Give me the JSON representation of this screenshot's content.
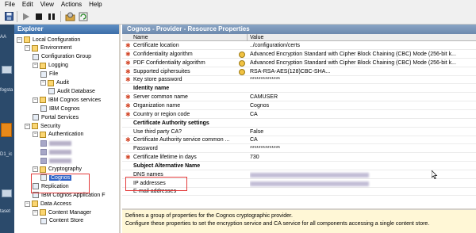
{
  "menu": [
    "File",
    "Edit",
    "View",
    "Actions",
    "Help"
  ],
  "toolbar": {
    "icons": [
      "save-icon",
      "play-icon",
      "stop-icon",
      "pause-icon",
      "tools-icon",
      "refresh-icon"
    ]
  },
  "background_window": {
    "labels": [
      "AA",
      "fogsta",
      "D1_ic",
      "taset"
    ]
  },
  "explorer": {
    "title": "Explorer",
    "tree": [
      {
        "label": "Local Configuration",
        "level": 0,
        "expander": "−"
      },
      {
        "label": "Environment",
        "level": 1,
        "expander": "−"
      },
      {
        "label": "Configuration Group",
        "level": 2,
        "expander": ""
      },
      {
        "label": "Logging",
        "level": 2,
        "expander": "−"
      },
      {
        "label": "File",
        "level": 3,
        "expander": ""
      },
      {
        "label": "Audit",
        "level": 3,
        "expander": "−"
      },
      {
        "label": "Audit Database",
        "level": 4,
        "expander": ""
      },
      {
        "label": "IBM Cognos services",
        "level": 2,
        "expander": "−"
      },
      {
        "label": "IBM Cognos",
        "level": 3,
        "expander": ""
      },
      {
        "label": "Portal Services",
        "level": 2,
        "expander": ""
      },
      {
        "label": "Security",
        "level": 1,
        "expander": "−"
      },
      {
        "label": "Authentication",
        "level": 2,
        "expander": "−"
      },
      {
        "label": "",
        "level": 3,
        "expander": ""
      },
      {
        "label": "",
        "level": 3,
        "expander": ""
      },
      {
        "label": "",
        "level": 3,
        "expander": ""
      },
      {
        "label": "Cryptography",
        "level": 2,
        "expander": "−"
      },
      {
        "label": "Cognos",
        "level": 3,
        "expander": "",
        "selected": true
      },
      {
        "label": "Replication",
        "level": 2,
        "expander": ""
      },
      {
        "label": "IBM Cognos Application F",
        "level": 2,
        "expander": ""
      },
      {
        "label": "Data Access",
        "level": 1,
        "expander": "−"
      },
      {
        "label": "Content Manager",
        "level": 2,
        "expander": "−"
      },
      {
        "label": "Content Store",
        "level": 3,
        "expander": ""
      }
    ]
  },
  "properties": {
    "title": "Cognos - Provider - Resource Properties",
    "columns": {
      "name": "Name",
      "value": "Value"
    },
    "rows": [
      {
        "type": "row",
        "required": true,
        "name": "Certificate location",
        "value": "../configuration/certs",
        "icon": false
      },
      {
        "type": "row",
        "required": true,
        "name": "Confidentiality algorithm",
        "value": "Advanced Encryption Standard with Cipher Block Chaining (CBC) Mode (256-bit k...",
        "icon": true
      },
      {
        "type": "row",
        "required": true,
        "name": "PDF Confidentiality algorithm",
        "value": "Advanced Encryption Standard with Cipher Block Chaining (CBC) Mode (256-bit k...",
        "icon": true
      },
      {
        "type": "row",
        "required": true,
        "name": "Supported ciphersuites",
        "value": "RSA-RSA-AES(128)CBC-SHA...",
        "icon": true
      },
      {
        "type": "row",
        "required": true,
        "name": "Key store password",
        "value": "**************",
        "icon": false
      },
      {
        "type": "section",
        "name": "Identity name"
      },
      {
        "type": "row",
        "required": true,
        "name": "Server common name",
        "value": "CAMUSER",
        "icon": false
      },
      {
        "type": "row",
        "required": true,
        "name": "Organization name",
        "value": "Cognos",
        "icon": false
      },
      {
        "type": "row",
        "required": true,
        "name": "Country or region code",
        "value": "CA",
        "icon": false
      },
      {
        "type": "section",
        "name": "Certificate Authority settings"
      },
      {
        "type": "row",
        "required": false,
        "name": "Use third party CA?",
        "value": "False",
        "icon": false
      },
      {
        "type": "row",
        "required": true,
        "name": "Certificate Authority service common ...",
        "value": "CA",
        "icon": false
      },
      {
        "type": "row",
        "required": false,
        "name": "Password",
        "value": "**************",
        "icon": false
      },
      {
        "type": "row",
        "required": true,
        "name": "Certificate lifetime in days",
        "value": "730",
        "icon": false
      },
      {
        "type": "section",
        "name": "Subject Alternative Name"
      },
      {
        "type": "row",
        "required": false,
        "name": "DNS names",
        "value": "",
        "icon": false,
        "blurred": true
      },
      {
        "type": "row",
        "required": false,
        "name": "IP addresses",
        "value": "",
        "icon": false,
        "blurred": true
      },
      {
        "type": "row",
        "required": false,
        "name": "E-mail addresses",
        "value": "",
        "icon": false,
        "blurred": false
      }
    ]
  },
  "description": {
    "line1": "Defines a group of properties for the Cognos cryptographic provider.",
    "line2": "Configure these properties to set the encryption service and CA service for all components accessing a single content store."
  }
}
